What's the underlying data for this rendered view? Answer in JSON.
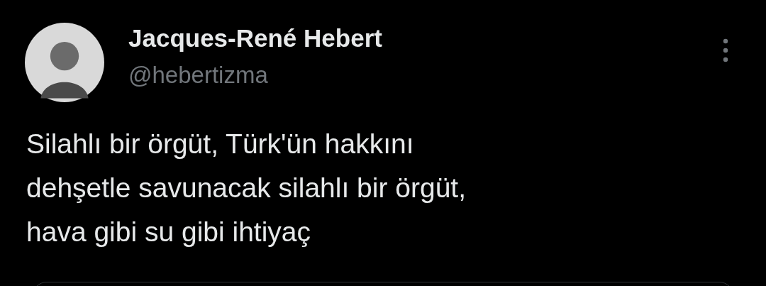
{
  "author": {
    "name": "Jacques-René Hebert",
    "handle": "@hebertizma"
  },
  "tweet": {
    "lines": [
      "Silahlı bir örgüt, Türk'ün hakkını",
      "dehşetle savunacak silahlı bir örgüt,",
      "hava gibi su gibi ihtiyaç"
    ]
  }
}
